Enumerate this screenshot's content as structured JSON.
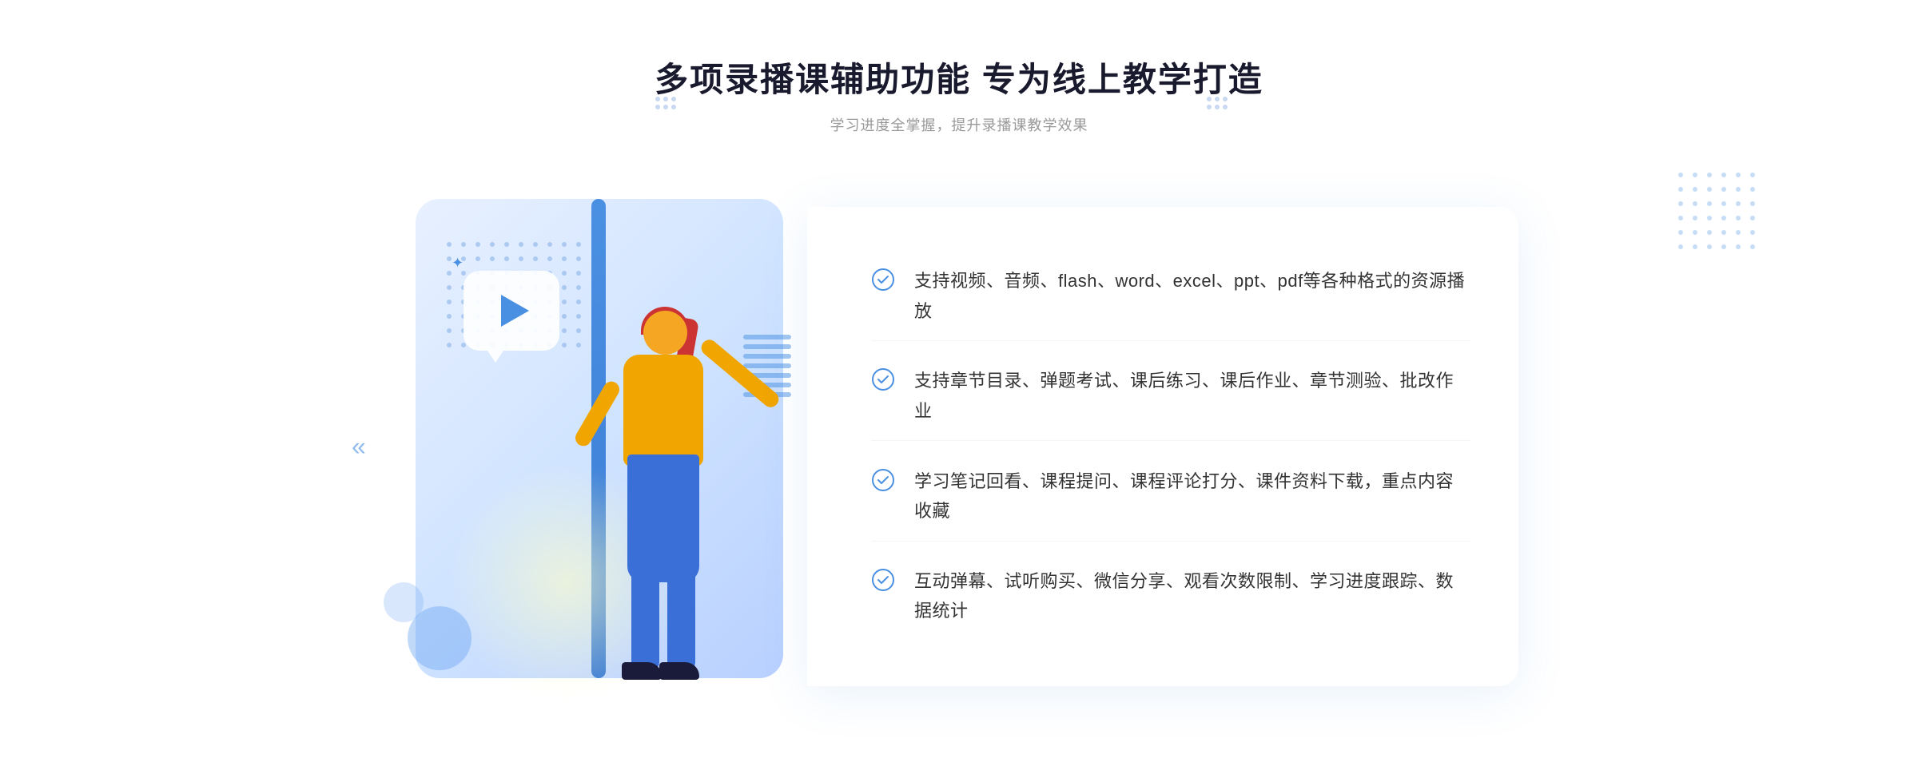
{
  "header": {
    "title": "多项录播课辅助功能 专为线上教学打造",
    "subtitle": "学习进度全掌握，提升录播课教学效果"
  },
  "features": [
    {
      "id": "feature-1",
      "text": "支持视频、音频、flash、word、excel、ppt、pdf等各种格式的资源播放"
    },
    {
      "id": "feature-2",
      "text": "支持章节目录、弹题考试、课后练习、课后作业、章节测验、批改作业"
    },
    {
      "id": "feature-3",
      "text": "学习笔记回看、课程提问、课程评论打分、课件资料下载，重点内容收藏"
    },
    {
      "id": "feature-4",
      "text": "互动弹幕、试听购买、微信分享、观看次数限制、学习进度跟踪、数据统计"
    }
  ],
  "colors": {
    "accent": "#4a90e2",
    "title": "#1a1a2e",
    "subtitle": "#999999",
    "text": "#333333"
  },
  "decorative": {
    "chevron_left": "«",
    "play_icon": "▶"
  }
}
